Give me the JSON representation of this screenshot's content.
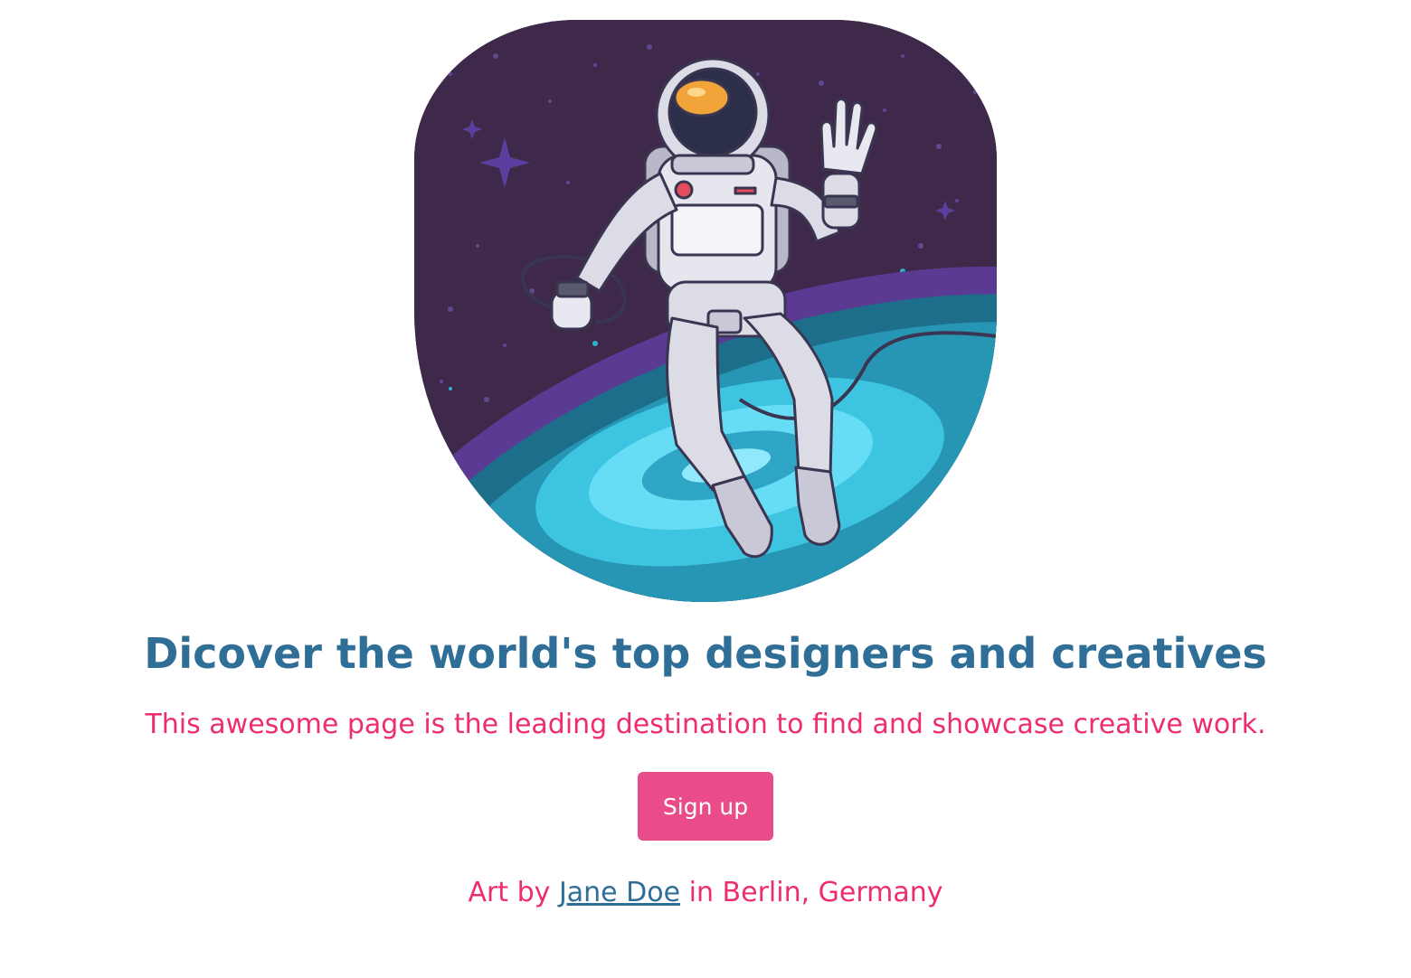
{
  "hero": {
    "title": "Dicover the world's top designers and creatives",
    "subtitle": "This awesome page is the leading destination to find and showcase creative work.",
    "signup_label": "Sign up"
  },
  "credit": {
    "prefix": "Art by",
    "artist": "Jane Doe",
    "suffix": "in Berlin, Germany"
  },
  "colors": {
    "heading": "#2f6f97",
    "accent_text": "#ee2e6b",
    "button": "#ea4c89",
    "space": "#3f294a",
    "planet": "#2aa7c4"
  },
  "illustration": {
    "icon": "astronaut-illustration"
  }
}
